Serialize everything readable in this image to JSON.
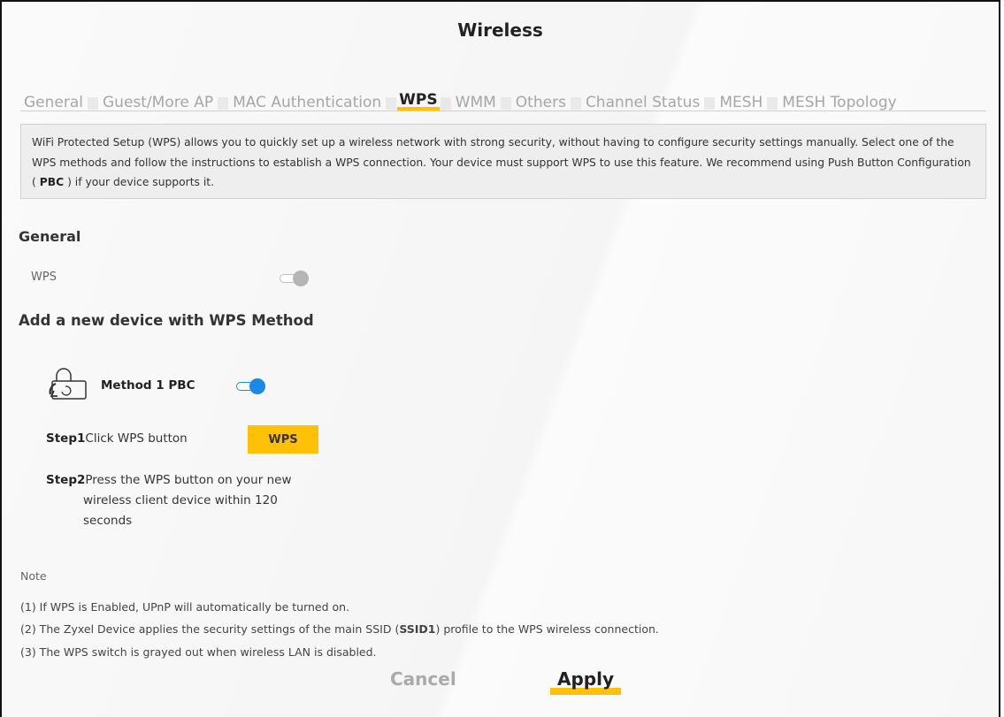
{
  "page": {
    "title": "Wireless"
  },
  "tabs": [
    {
      "label": "General"
    },
    {
      "label": "Guest/More AP"
    },
    {
      "label": "MAC Authentication"
    },
    {
      "label": "WPS"
    },
    {
      "label": "WMM"
    },
    {
      "label": "Others"
    },
    {
      "label": "Channel Status"
    },
    {
      "label": "MESH"
    },
    {
      "label": "MESH Topology"
    }
  ],
  "active_tab": "WPS",
  "info": {
    "text_1": "WiFi Protected Setup (WPS) allows you to quickly set up a wireless network with strong security, without having to configure security settings manually. Select one of the WPS methods and follow the instructions to establish a WPS connection. Your device must support WPS to use this feature. We recommend using Push Button Configuration (",
    "bold": "PBC",
    "text_2": ") if your device supports it."
  },
  "general": {
    "heading": "General",
    "wps_label": "WPS",
    "wps_enabled": false
  },
  "method": {
    "heading": "Add a new device with WPS Method",
    "method1_label": "Method 1 PBC",
    "method1_enabled": true,
    "step1_label": "Step1",
    "step1_text": "Click WPS button",
    "wps_button": "WPS",
    "step2_label": "Step2",
    "step2_line1": "Press the WPS button on your new",
    "step2_line2": "wireless client device within 120",
    "step2_line3": "seconds"
  },
  "notes": {
    "heading": "Note",
    "note1": "(1) If WPS is Enabled, UPnP will automatically be turned on.",
    "note2_a": "(2) The Zyxel Device applies the security settings of the main SSID (",
    "note2_bold": "SSID1",
    "note2_b": ") profile to the WPS wireless connection.",
    "note3": "(3) The WPS switch is grayed out when wireless LAN is disabled."
  },
  "footer": {
    "cancel": "Cancel",
    "apply": "Apply"
  },
  "colors": {
    "accent": "#ffc107",
    "toggle_on": "#1e88e5",
    "toggle_off": "#b5b5b5"
  },
  "icons": {
    "method1": "lock-refresh-icon"
  }
}
